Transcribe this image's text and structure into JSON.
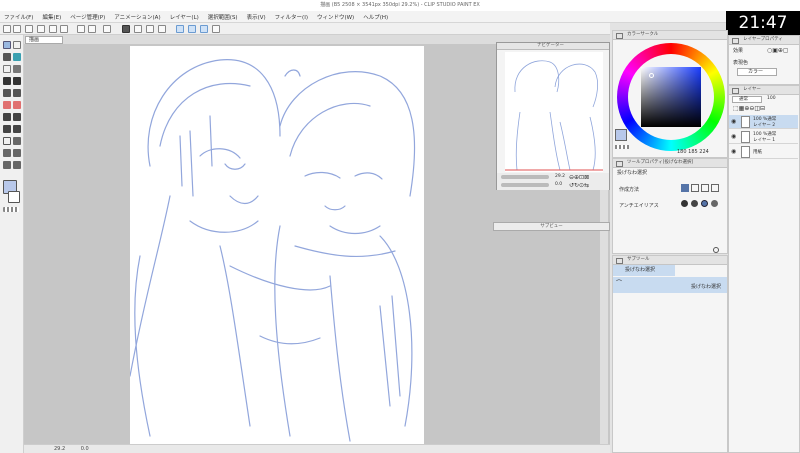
{
  "app": {
    "title": "描画 (B5 2508 × 3541px 350dpi 29.2%) - CLIP STUDIO PAINT EX"
  },
  "menu": [
    "ファイル(F)",
    "編集(E)",
    "ページ管理(P)",
    "アニメーション(A)",
    "レイヤー(L)",
    "選択範囲(S)",
    "表示(V)",
    "フィルター(I)",
    "ウィンドウ(W)",
    "ヘルプ(H)"
  ],
  "clock": "21:47",
  "canvas": {
    "tab_label": "描画",
    "status_zoom": "29.2",
    "status_angle": "0.0"
  },
  "navigator": {
    "title": "ナビゲーター",
    "zoom": "29.2",
    "angle": "0.0"
  },
  "subview": {
    "title": "サブビュー"
  },
  "color_wheel": {
    "title": "カラーサークル",
    "hsv": [
      "180",
      "185",
      "224"
    ]
  },
  "layer_property": {
    "title": "レイヤープロパティ",
    "effect_label": "効果",
    "expression_label": "表現色",
    "expression_value": "カラー"
  },
  "layers": {
    "title": "レイヤー",
    "blend": "通常",
    "opacity": "100",
    "items": [
      {
        "opacity": "100 %通常",
        "name": "レイヤー 2"
      },
      {
        "opacity": "100 %通常",
        "name": "レイヤー 1"
      },
      {
        "opacity": "",
        "name": "用紙"
      }
    ]
  },
  "tool_property": {
    "title": "ツールプロパティ[投げなわ選択]",
    "tool_name": "投げなわ選択",
    "mode_label": "作成方法",
    "antialias_label": "アンチエイリアス"
  },
  "sub_tool": {
    "title": "サブツール",
    "group_name": "投げなわ選択",
    "item_name": "投げなわ選択"
  },
  "colors": {
    "sketch": "#7f97d6",
    "accent": "#c8dbf0",
    "main_color": "#b8c8ea"
  }
}
